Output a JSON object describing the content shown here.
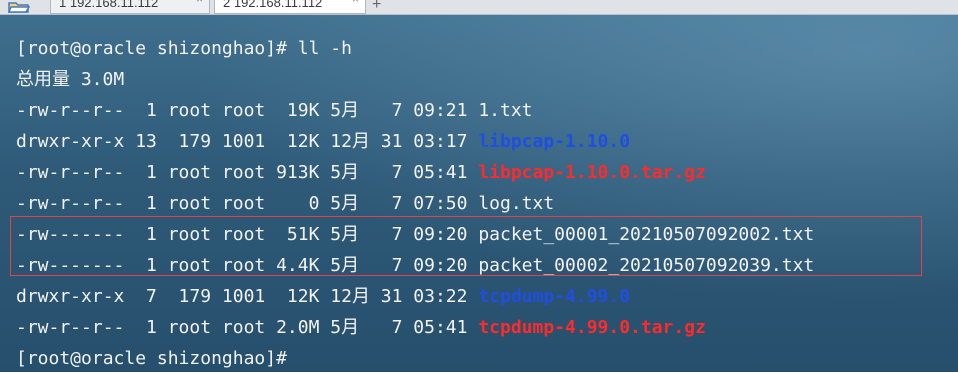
{
  "tabs": [
    {
      "label": "1 192.168.11.112",
      "active": false
    },
    {
      "label": "2 192.168.11.112",
      "active": true
    }
  ],
  "icons": {
    "folder": "folder-open-icon",
    "close": "close-icon",
    "add": "plus-icon"
  },
  "colors": {
    "directory": "#1f4fe0",
    "archive": "#ff2a2a",
    "text": "#f2f2f2",
    "highlight_border": "#e0444a"
  },
  "terminal": {
    "command_line": "[root@oracle shizonghao]# ll -h",
    "total_line": "总用量 3.0M",
    "entries": [
      {
        "meta": "-rw-r--r--  1 root root  19K 5月   7 09:21 ",
        "name": "1.txt",
        "type": "file"
      },
      {
        "meta": "drwxr-xr-x 13  179 1001  12K 12月 31 03:17 ",
        "name": "libpcap-1.10.0",
        "type": "dir"
      },
      {
        "meta": "-rw-r--r--  1 root root 913K 5月   7 05:41 ",
        "name": "libpcap-1.10.0.tar.gz",
        "type": "archive"
      },
      {
        "meta": "-rw-r--r--  1 root root    0 5月   7 07:50 ",
        "name": "log.txt",
        "type": "file"
      },
      {
        "meta": "-rw-------  1 root root  51K 5月   7 09:20 ",
        "name": "packet_00001_20210507092002.txt",
        "type": "file"
      },
      {
        "meta": "-rw-------  1 root root 4.4K 5月   7 09:20 ",
        "name": "packet_00002_20210507092039.txt",
        "type": "file"
      },
      {
        "meta": "drwxr-xr-x  7  179 1001  12K 12月 31 03:22 ",
        "name": "tcpdump-4.99.0",
        "type": "dir"
      },
      {
        "meta": "-rw-r--r--  1 root root 2.0M 5月   7 05:41 ",
        "name": "tcpdump-4.99.0.tar.gz",
        "type": "archive"
      }
    ],
    "prompt_line": "[root@oracle shizonghao]#"
  }
}
